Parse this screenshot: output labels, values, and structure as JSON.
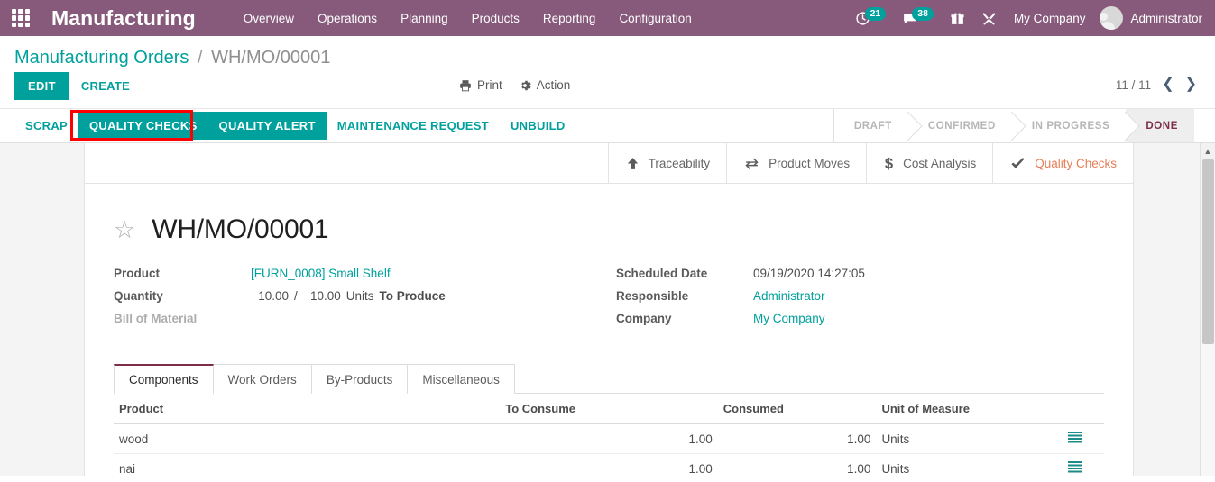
{
  "navbar": {
    "apps_icon": "apps-grid-icon",
    "brand": "Manufacturing",
    "menu": [
      {
        "label": "Overview"
      },
      {
        "label": "Operations"
      },
      {
        "label": "Planning"
      },
      {
        "label": "Products"
      },
      {
        "label": "Reporting"
      },
      {
        "label": "Configuration"
      }
    ],
    "systray": {
      "activities_icon": "clock-icon",
      "activities_count": "21",
      "messages_icon": "chat-bubble-icon",
      "messages_count": "38",
      "gift_icon": "gift-icon",
      "tools_icon": "wrench-icon",
      "company": "My Company",
      "user": "Administrator"
    },
    "brand_color": "#875A7B",
    "badge_color": "#00A09D"
  },
  "control_panel": {
    "breadcrumb_root": "Manufacturing Orders",
    "breadcrumb_sep": "/",
    "breadcrumb_current": "WH/MO/00001",
    "edit_label": "EDIT",
    "create_label": "CREATE",
    "print_label": "Print",
    "print_icon": "printer-icon",
    "action_label": "Action",
    "action_icon": "gear-icon",
    "pager_value": "11 / 11",
    "pager_prev_icon": "chevron-left-icon",
    "pager_next_icon": "chevron-right-icon"
  },
  "action_buttons": [
    {
      "label": "SCRAP",
      "style": "link"
    },
    {
      "label": "QUALITY CHECKS",
      "style": "filled",
      "highlighted": true
    },
    {
      "label": "QUALITY ALERT",
      "style": "filled"
    },
    {
      "label": "MAINTENANCE REQUEST",
      "style": "link"
    },
    {
      "label": "UNBUILD",
      "style": "link"
    }
  ],
  "highlight_color": "#FF0000",
  "statusbar": {
    "steps": [
      {
        "label": "DRAFT",
        "active": false
      },
      {
        "label": "CONFIRMED",
        "active": false
      },
      {
        "label": "IN PROGRESS",
        "active": false
      },
      {
        "label": "DONE",
        "active": true
      }
    ]
  },
  "stat_buttons": [
    {
      "label": "Traceability",
      "icon": "arrow-up-icon",
      "accent": false
    },
    {
      "label": "Product Moves",
      "icon": "exchange-icon",
      "accent": false
    },
    {
      "label": "Cost Analysis",
      "icon": "dollar-icon",
      "accent": false
    },
    {
      "label": "Quality Checks",
      "icon": "check-icon",
      "accent": true
    }
  ],
  "record": {
    "star_icon": "star-outline-icon",
    "title": "WH/MO/00001",
    "left_fields": {
      "product_label": "Product",
      "product_value": "[FURN_0008] Small Shelf",
      "quantity_label": "Quantity",
      "quantity_done": "10.00",
      "quantity_sep": "/",
      "quantity_total": "10.00",
      "quantity_uom": "Units",
      "quantity_suffix": "To Produce",
      "bom_label": "Bill of Material",
      "bom_value": ""
    },
    "right_fields": {
      "scheduled_label": "Scheduled Date",
      "scheduled_value": "09/19/2020 14:27:05",
      "responsible_label": "Responsible",
      "responsible_value": "Administrator",
      "company_label": "Company",
      "company_value": "My Company"
    }
  },
  "notebook": {
    "tabs": [
      {
        "label": "Components",
        "active": true
      },
      {
        "label": "Work Orders",
        "active": false
      },
      {
        "label": "By-Products",
        "active": false
      },
      {
        "label": "Miscellaneous",
        "active": false
      }
    ],
    "columns": [
      "Product",
      "To Consume",
      "Consumed",
      "Unit of Measure",
      ""
    ],
    "rows": [
      {
        "product": "wood",
        "to_consume": "1.00",
        "consumed": "1.00",
        "uom": "Units",
        "action_icon": "list-lines-icon"
      },
      {
        "product": "nai",
        "to_consume": "1.00",
        "consumed": "1.00",
        "uom": "Units",
        "action_icon": "list-lines-icon"
      }
    ]
  },
  "scrollbar": {
    "up_arrow_icon": "caret-up-icon"
  }
}
